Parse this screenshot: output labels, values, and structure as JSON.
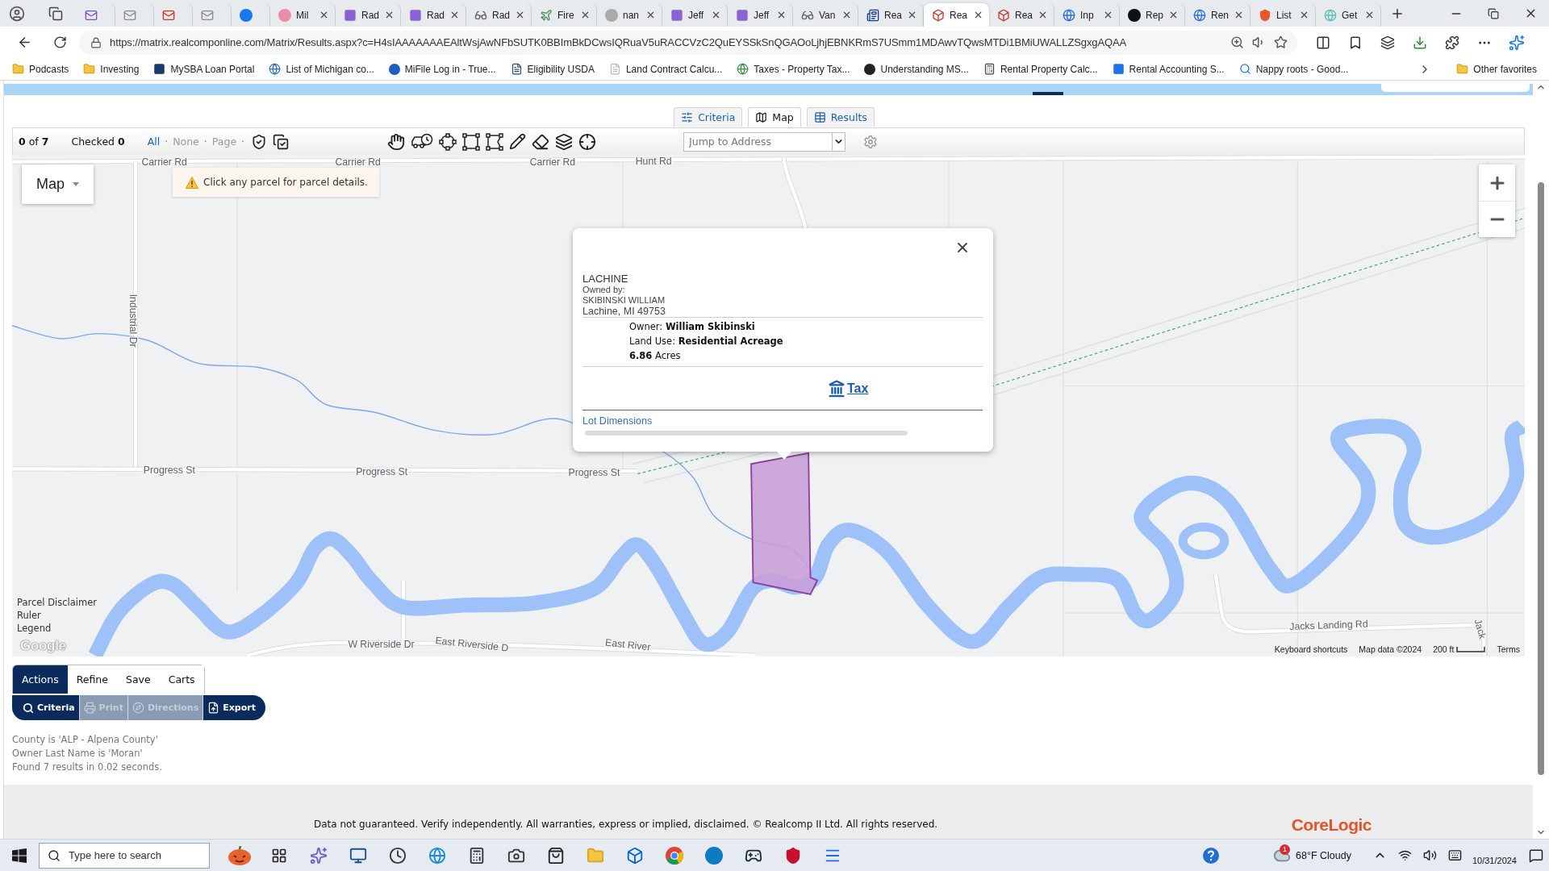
{
  "browser_tabs": [
    {
      "selected": false
    },
    {
      "selected": false
    },
    {
      "selected": false
    },
    {
      "selected": false
    },
    {
      "selected": false
    },
    {
      "title": "Mil",
      "selected": false
    },
    {
      "title": "Rad",
      "selected": false
    },
    {
      "title": "Rad",
      "selected": false
    },
    {
      "title": "Rad",
      "selected": false
    },
    {
      "title": "Fire",
      "selected": false
    },
    {
      "title": "nan",
      "selected": false
    },
    {
      "title": "Jeff",
      "selected": false
    },
    {
      "title": "Jeff",
      "selected": false
    },
    {
      "title": "Van",
      "selected": false
    },
    {
      "title": "Rea",
      "selected": false
    },
    {
      "title": "Rea",
      "selected": true
    },
    {
      "title": "Rea",
      "selected": false
    },
    {
      "title": "Inp",
      "selected": false
    },
    {
      "title": "Rep",
      "selected": false
    },
    {
      "title": "Ren",
      "selected": false
    },
    {
      "title": "List",
      "selected": false
    },
    {
      "title": "Get",
      "selected": false
    }
  ],
  "address_bar": {
    "url": "https://matrix.realcomponline.com/Matrix/Results.aspx?c=H4sIAAAAAAAEAltWsjAwNFbSUTK0BBImBkDCwsIQRuaV5uRACCVzC2QuEYSSkSnQGAOoLjhjEBNKRmS7USmm1MDAwvTQwsMTDi1BMiUWALLZSgxgAQAA"
  },
  "bookmarks": [
    {
      "label": "Podcasts",
      "kind": "folder"
    },
    {
      "label": "Investing",
      "kind": "folder"
    },
    {
      "label": "MySBA Loan Portal",
      "kind": "link"
    },
    {
      "label": "List of Michigan co...",
      "kind": "link"
    },
    {
      "label": "MiFile Log in - True...",
      "kind": "link"
    },
    {
      "label": "Eligibility USDA",
      "kind": "link"
    },
    {
      "label": "Land Contract Calcu...",
      "kind": "link"
    },
    {
      "label": "Taxes - Property Tax...",
      "kind": "link"
    },
    {
      "label": "Understanding MS...",
      "kind": "link"
    },
    {
      "label": "Rental Property Calc...",
      "kind": "link"
    },
    {
      "label": "Rental Accounting S...",
      "kind": "link"
    },
    {
      "label": "Nappy roots - Good...",
      "kind": "link"
    }
  ],
  "other_favorites": {
    "label": "Other favorites",
    "kind": "folder"
  },
  "view_tabs": [
    {
      "label": "Criteria",
      "selected": false
    },
    {
      "label": "Map",
      "selected": true
    },
    {
      "label": "Results",
      "selected": false
    }
  ],
  "toolbar": {
    "result_count": "**0** of **7**",
    "checked_count": "Checked **0**",
    "select_links": [
      {
        "label": "All",
        "separator": "·",
        "disabled": false
      },
      {
        "label": "None",
        "separator": "·",
        "disabled": true
      },
      {
        "label": "Page",
        "separator": "·",
        "disabled": true
      }
    ],
    "jump_to_address": {
      "placeholder": "Jump to Address"
    }
  },
  "map": {
    "layer_menu": "Map",
    "notice": "Click any parcel for parcel details.",
    "road_labels": [
      "Carrier Rd",
      "Carrier Rd",
      "Carrier Rd",
      "Hunt Rd",
      "Industrial Dr",
      "Progress St",
      "Progress St",
      "Progress St",
      "W Riverside Dr",
      "East Riverside D",
      "East River",
      "Jacks Landing Rd",
      "Jack"
    ],
    "links": [
      "Parcel Disclaimer",
      "Ruler",
      "Legend"
    ],
    "logo": "Google",
    "attribution": {
      "shortcuts": "Keyboard shortcuts",
      "map_data": "Map data ©2024",
      "scale": "200 ft",
      "terms": "Terms"
    },
    "popup": {
      "area": "LACHINE",
      "owned_by_label": "Owned by:",
      "owner_name": "SKIBINSKI WILLIAM",
      "location": "Lachine, MI 49753",
      "details": [
        "Owner: **William Skibinski**",
        "Land Use: **Residential Acreage**",
        "**6.86** Acres"
      ],
      "tax_link": "Tax",
      "lot_link": "Lot Dimensions"
    }
  },
  "action_tabs": [
    {
      "label": "Actions",
      "selected": true
    },
    {
      "label": "Refine",
      "selected": false
    },
    {
      "label": "Save",
      "selected": false
    },
    {
      "label": "Carts",
      "selected": false
    }
  ],
  "action_buttons": [
    {
      "label": "Criteria",
      "disabled": false
    },
    {
      "label": "Print",
      "disabled": true
    },
    {
      "label": "Directions",
      "disabled": true
    },
    {
      "label": "Export",
      "disabled": false
    }
  ],
  "criteria_summary": [
    "County is 'ALP - Alpena County'",
    "Owner Last Name is 'Moran'",
    "Found 7 results in 0.02 seconds."
  ],
  "footer": {
    "disclaimer": "Data not guaranteed. Verify independently. All warranties, express or implied, disclaimed. © Realcomp II Ltd. All rights reserved.",
    "logo": "CoreLogic"
  },
  "taskbar": {
    "search": {
      "placeholder": "Type here to search"
    },
    "weather": {
      "badge": "1",
      "text": "68°F Cloudy"
    },
    "date": "10/31/2024"
  }
}
